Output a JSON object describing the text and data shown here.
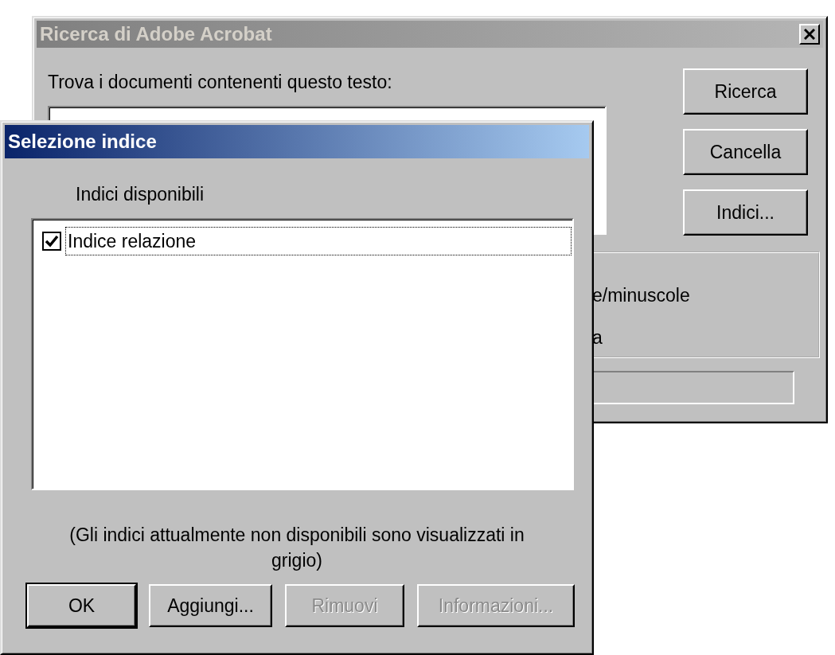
{
  "background_window": {
    "title": "Ricerca di Adobe Acrobat",
    "active": false,
    "search_label": "Trova i documenti contenenti questo testo:",
    "buttons": [
      {
        "label": "Ricerca"
      },
      {
        "label": "Cancella"
      },
      {
        "label": "Indici..."
      }
    ],
    "options": [
      {
        "label": "e/minuscole"
      },
      {
        "label": "a"
      }
    ]
  },
  "dialog": {
    "title": "Selezione indice",
    "active": true,
    "list_label": "Indici disponibili",
    "indexes": [
      {
        "label": "Indice relazione",
        "checked": true,
        "focused": true
      }
    ],
    "note": "(Gli indici attualmente non disponibili sono visualizzati in grigio)",
    "buttons": [
      {
        "label": "OK",
        "default": true,
        "disabled": false
      },
      {
        "label": "Aggiungi...",
        "default": false,
        "disabled": false
      },
      {
        "label": "Rimuovi",
        "default": false,
        "disabled": true
      },
      {
        "label": "Informazioni...",
        "default": false,
        "disabled": true
      }
    ]
  }
}
